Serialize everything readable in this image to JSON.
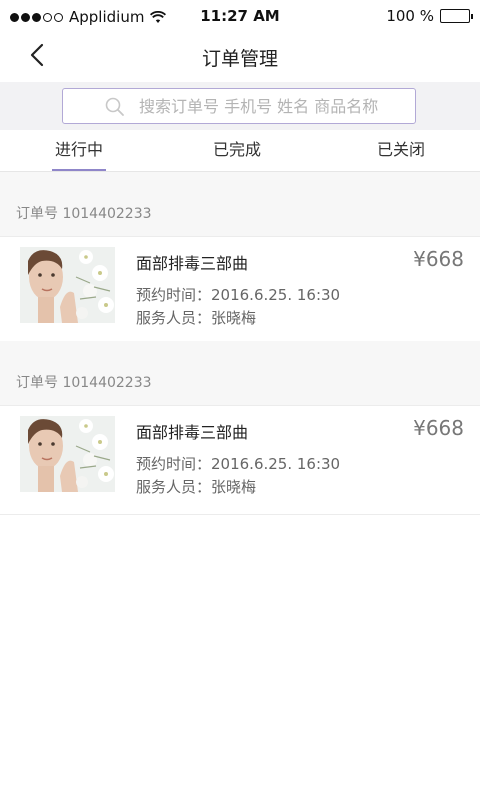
{
  "status_bar": {
    "carrier": "Applidium",
    "time": "11:27 AM",
    "battery": "100 %"
  },
  "nav": {
    "title": "订单管理",
    "back_icon": "chevron-left-icon"
  },
  "search": {
    "placeholder": "搜索订单号 手机号 姓名 商品名称",
    "value": ""
  },
  "tabs": [
    {
      "label": "进行中",
      "active": true
    },
    {
      "label": "已完成",
      "active": false
    },
    {
      "label": "已关闭",
      "active": false
    }
  ],
  "orders": [
    {
      "order_no": "订单号 1014402233",
      "name": "面部排毒三部曲",
      "time": "预约时间：2016.6.25. 16:30",
      "staff": "服务人员：张晓梅",
      "price": "¥668"
    },
    {
      "order_no": "订单号 1014402233",
      "name": "面部排毒三部曲",
      "time": "预约时间：2016.6.25. 16:30",
      "staff": "服务人员：张晓梅",
      "price": "¥668"
    }
  ],
  "colors": {
    "accent": "#8f86c9",
    "search_border": "#b2a9d6",
    "background": "#f7f7f7"
  }
}
